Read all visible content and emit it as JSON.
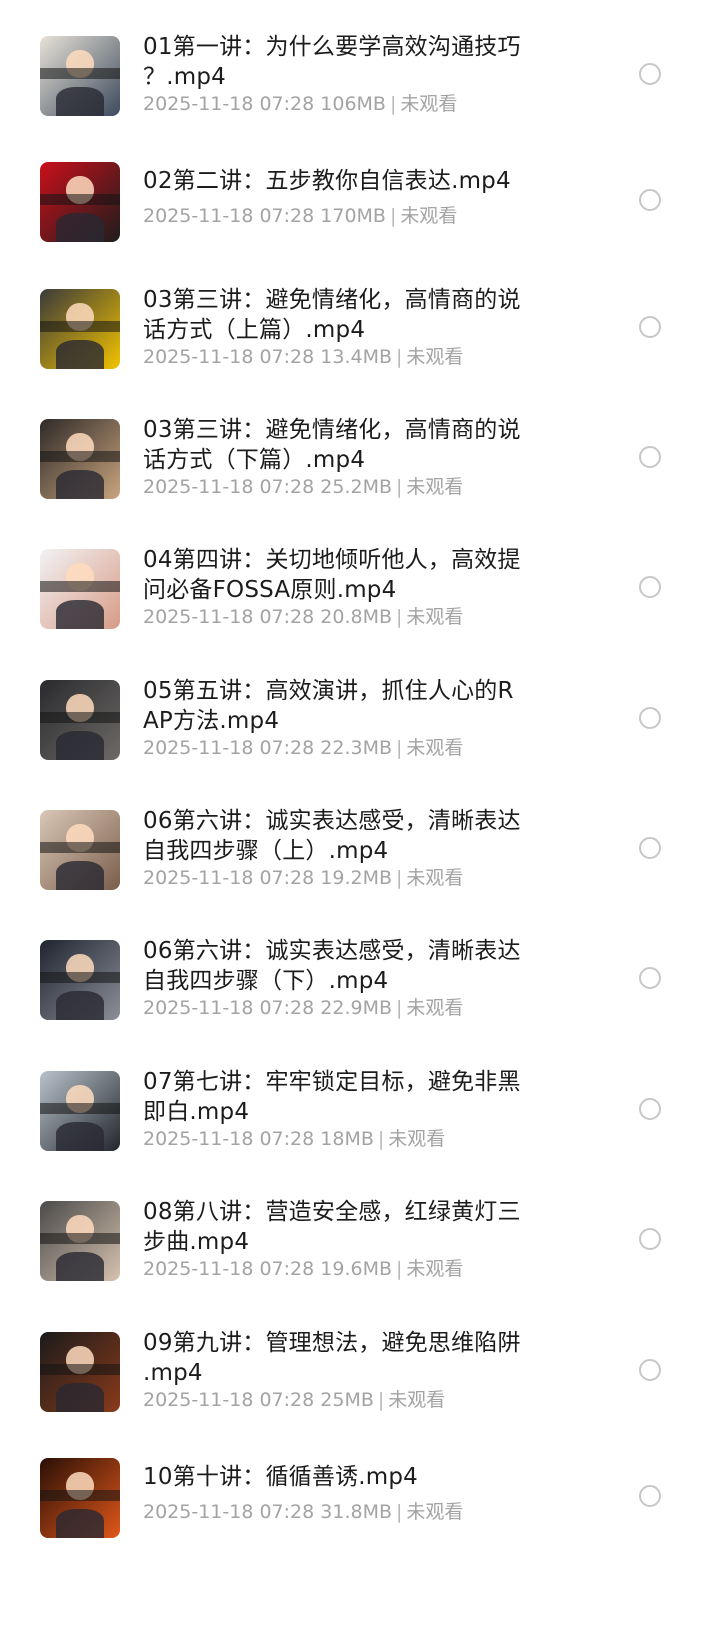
{
  "meta_separator": "|",
  "files": [
    {
      "title_lines": [
        "01第一讲：为什么要学高效沟通技巧",
        "？.mp4"
      ],
      "date": "2025-11-18 07:28",
      "size": "106MB",
      "status": "未观看",
      "thumb_colors": [
        "#e8e2d8",
        "#3b4a5c"
      ]
    },
    {
      "title_lines": [
        "02第二讲：五步教你自信表达.mp4"
      ],
      "date": "2025-11-18 07:28",
      "size": "170MB",
      "status": "未观看",
      "thumb_colors": [
        "#c9101a",
        "#1d1d1d"
      ]
    },
    {
      "title_lines": [
        "03第三讲：避免情绪化，高情商的说",
        "话方式（上篇）.mp4"
      ],
      "date": "2025-11-18 07:28",
      "size": "13.4MB",
      "status": "未观看",
      "thumb_colors": [
        "#3a3a3a",
        "#f2c200"
      ]
    },
    {
      "title_lines": [
        "03第三讲：避免情绪化，高情商的说",
        "话方式（下篇）.mp4"
      ],
      "date": "2025-11-18 07:28",
      "size": "25.2MB",
      "status": "未观看",
      "thumb_colors": [
        "#2e2a28",
        "#c9a47e"
      ]
    },
    {
      "title_lines": [
        "04第四讲：关切地倾听他人，高效提",
        "问必备FOSSA原则.mp4"
      ],
      "date": "2025-11-18 07:28",
      "size": "20.8MB",
      "status": "未观看",
      "thumb_colors": [
        "#f2f2f4",
        "#d79b86"
      ]
    },
    {
      "title_lines": [
        "05第五讲：高效演讲，抓住人心的R",
        "AP方法.mp4"
      ],
      "date": "2025-11-18 07:28",
      "size": "22.3MB",
      "status": "未观看",
      "thumb_colors": [
        "#2a2a2e",
        "#6d6a66"
      ]
    },
    {
      "title_lines": [
        "06第六讲：诚实表达感受，清晰表达",
        "自我四步骤（上）.mp4"
      ],
      "date": "2025-11-18 07:28",
      "size": "19.2MB",
      "status": "未观看",
      "thumb_colors": [
        "#d9c7b6",
        "#7a5e4c"
      ]
    },
    {
      "title_lines": [
        "06第六讲：诚实表达感受，清晰表达",
        "自我四步骤（下）.mp4"
      ],
      "date": "2025-11-18 07:28",
      "size": "22.9MB",
      "status": "未观看",
      "thumb_colors": [
        "#1f2430",
        "#8a8f98"
      ]
    },
    {
      "title_lines": [
        "07第七讲：牢牢锁定目标，避免非黑",
        "即白.mp4"
      ],
      "date": "2025-11-18 07:28",
      "size": "18MB",
      "status": "未观看",
      "thumb_colors": [
        "#b9c3cc",
        "#22262c"
      ]
    },
    {
      "title_lines": [
        "08第八讲：营造安全感，红绿黄灯三",
        "步曲.mp4"
      ],
      "date": "2025-11-18 07:28",
      "size": "19.6MB",
      "status": "未观看",
      "thumb_colors": [
        "#4a4a4a",
        "#d6c2ae"
      ]
    },
    {
      "title_lines": [
        "09第九讲：管理想法，避免思维陷阱",
        ".mp4"
      ],
      "date": "2025-11-18 07:28",
      "size": "25MB",
      "status": "未观看",
      "thumb_colors": [
        "#1b1b1b",
        "#8a3a1a"
      ]
    },
    {
      "title_lines": [
        "10第十讲：循循善诱.mp4"
      ],
      "date": "2025-11-18 07:28",
      "size": "31.8MB",
      "status": "未观看",
      "thumb_colors": [
        "#2a0f06",
        "#e0571a"
      ]
    }
  ]
}
